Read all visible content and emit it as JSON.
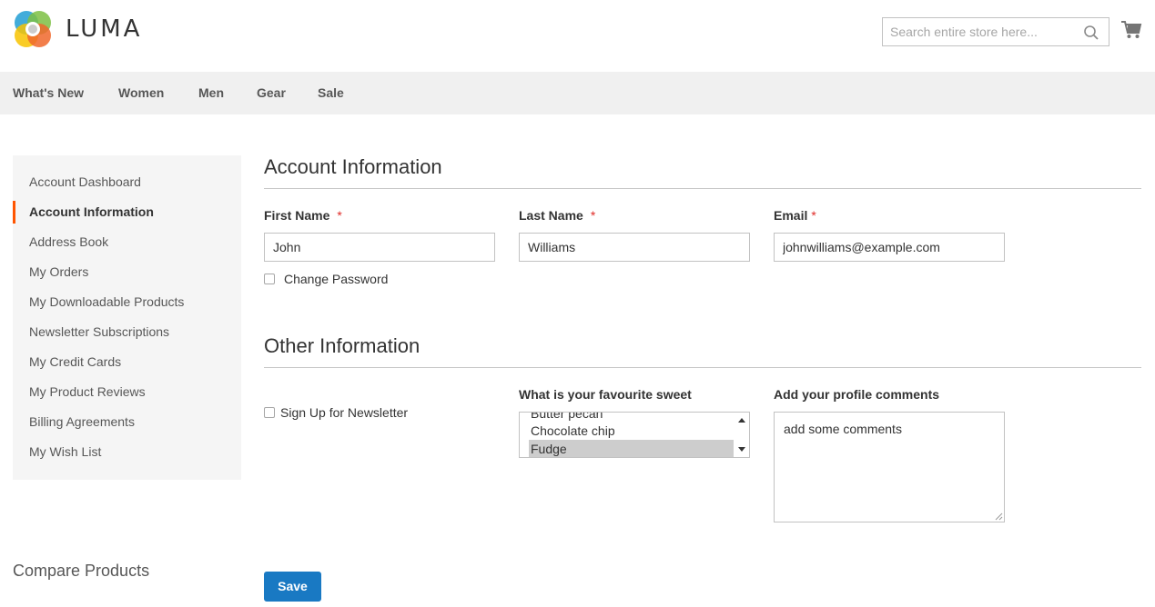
{
  "header": {
    "logo_text": "LUMA",
    "search_placeholder": "Search entire store here...",
    "search_icon": "search-icon",
    "cart_icon": "cart-icon"
  },
  "nav": {
    "items": [
      {
        "label": "What's New"
      },
      {
        "label": "Women"
      },
      {
        "label": "Men"
      },
      {
        "label": "Gear"
      },
      {
        "label": "Sale"
      }
    ]
  },
  "sidebar": {
    "active_index": 1,
    "accent_color": "#ff5501",
    "items": [
      {
        "label": "Account Dashboard"
      },
      {
        "label": "Account Information"
      },
      {
        "label": "Address Book"
      },
      {
        "label": "My Orders"
      },
      {
        "label": "My Downloadable Products"
      },
      {
        "label": "Newsletter Subscriptions"
      },
      {
        "label": "My Credit Cards"
      },
      {
        "label": "My Product Reviews"
      },
      {
        "label": "Billing Agreements"
      },
      {
        "label": "My Wish List"
      }
    ]
  },
  "compare": {
    "title": "Compare Products"
  },
  "account_info": {
    "title": "Account Information",
    "first_name": {
      "label": "First Name",
      "required": "*",
      "value": "John"
    },
    "last_name": {
      "label": "Last Name",
      "required": "*",
      "value": "Williams"
    },
    "email": {
      "label": "Email",
      "required": "*",
      "value": "johnwilliams@example.com"
    },
    "change_password": {
      "label": "Change Password",
      "checked": false
    }
  },
  "other_info": {
    "title": "Other Information",
    "newsletter": {
      "label": "Sign Up for Newsletter",
      "checked": false
    },
    "sweet": {
      "label": "What is your favourite sweet",
      "options": [
        "Butter pecan",
        "Chocolate chip",
        "Fudge"
      ],
      "selected": "Fudge"
    },
    "comments": {
      "label": "Add your profile comments",
      "value": "add some comments"
    }
  },
  "actions": {
    "save_label": "Save",
    "save_color": "#1979c3"
  }
}
